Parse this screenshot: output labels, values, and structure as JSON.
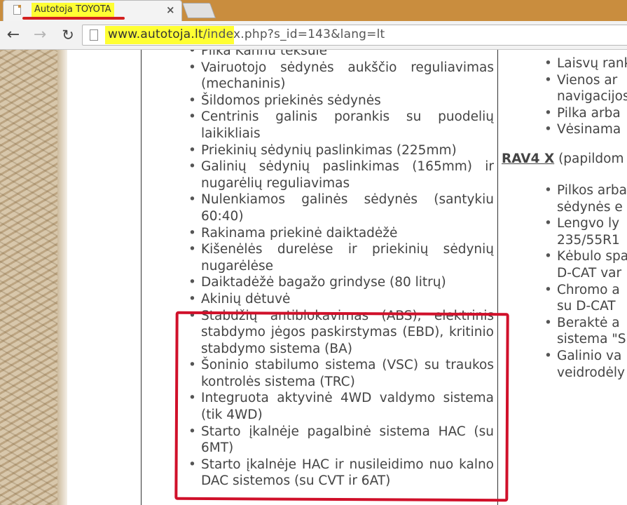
{
  "tab": {
    "title": "Autotoja TOYOTA",
    "close": "×"
  },
  "toolbar": {
    "back": "←",
    "forward": "→",
    "reload": "↻"
  },
  "address": {
    "host": "www.autotoja.lt",
    "path": "/index.php?s_id=143&lang=lt"
  },
  "left_column": {
    "items": [
      "Pilka  Kannu  teksule",
      "Vairuotojo sėdynės aukščio reguliavimas (mechaninis)",
      "Šildomos priekinės sėdynės",
      "Centrinis galinis porankis su puodelių laikikliais",
      "Priekinių sėdynių paslinkimas (225mm)",
      "Galinių sėdynių paslinkimas (165mm) ir nugarėlių reguliavimas",
      "Nulenkiamos galinės sėdynės (santykiu 60:40)",
      "Rakinama priekinė daiktadėžė",
      "Kišenėlės durelėse ir priekinių sėdynių nugarėlėse",
      "Daiktadėžė bagažo grindyse (80 litrų)",
      "Akinių dėtuvė",
      "Stabdžių antiblokavimas (ABS), elektrinis stabdymo jėgos paskirstymas (EBD), kritinio stabdymo sistema (BA)",
      "Šoninio stabilumo sistema (VSC) su traukos kontrolės sistema (TRC)",
      "Integruota aktyvinė 4WD valdymo sistema (tik 4WD)",
      "Starto įkalnėje pagalbinė sistema HAC (su 6MT)",
      "Starto įkalnėje HAC ir nusileidimo nuo kalno DAC sistemos (su CVT ir 6AT)"
    ]
  },
  "right_column": {
    "top_lines": [
      "Laisvų rank",
      "Vienos ar",
      "navigacijos",
      "Pilka arba",
      "Vėsinama"
    ],
    "heading_bold": "RAV4 X",
    "heading_rest": " (papildom",
    "bottom_lines": [
      "Pilkos arba",
      "sėdynės e",
      "Lengvo ly",
      "235/55R1",
      "Kėbulo spa",
      "D-CAT var",
      "Chromo a",
      "su D-CAT",
      "Beraktė a",
      "sistema \"S",
      "Galinio va",
      "veidrodėly"
    ]
  }
}
